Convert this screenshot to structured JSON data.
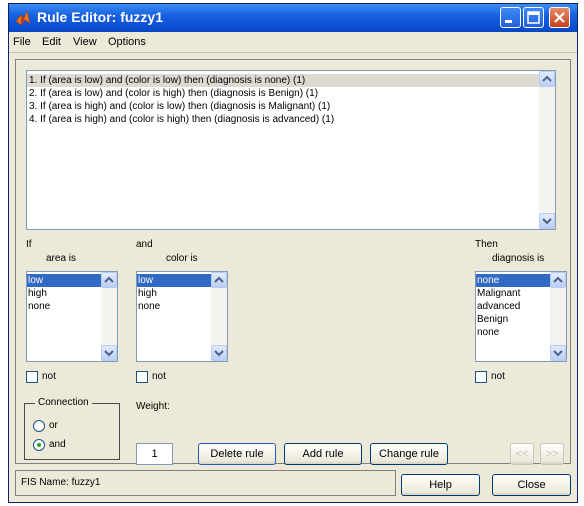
{
  "window": {
    "title": "Rule Editor: fuzzy1",
    "app_icon": "matlab-icon",
    "controls": [
      "minimize-icon",
      "maximize-icon",
      "close-icon"
    ]
  },
  "menu": [
    "File",
    "Edit",
    "View",
    "Options"
  ],
  "rules": [
    "1. If (area is low) and (color is low) then (diagnosis is none) (1)",
    "2. If (area is low) and (color is high) then (diagnosis is Benign) (1)",
    "3. If (area is high) and (color is low) then (diagnosis is Malignant) (1)",
    "4. If (area is high) and (color is high) then (diagnosis is advanced) (1)"
  ],
  "antecedent_1": {
    "keyword": "If",
    "label": "area is",
    "options": [
      "low",
      "high",
      "none"
    ],
    "selected": "low",
    "not_label": "not"
  },
  "antecedent_2": {
    "keyword": "and",
    "label": "color is",
    "options": [
      "low",
      "high",
      "none"
    ],
    "selected": "low",
    "not_label": "not"
  },
  "consequent": {
    "keyword": "Then",
    "label": "diagnosis is",
    "options": [
      "none",
      "Malignant",
      "advanced",
      "Benign",
      "none"
    ],
    "selected": "none",
    "not_label": "not"
  },
  "connection": {
    "title": "Connection",
    "options": [
      "or",
      "and"
    ],
    "selected": "and"
  },
  "weight": {
    "label": "Weight:",
    "value": "1"
  },
  "buttons": {
    "delete_rule": "Delete rule",
    "add_rule": "Add rule",
    "change_rule": "Change rule",
    "prev": "<<",
    "next": ">>",
    "help": "Help",
    "close": "Close"
  },
  "status": "FIS Name: fuzzy1"
}
